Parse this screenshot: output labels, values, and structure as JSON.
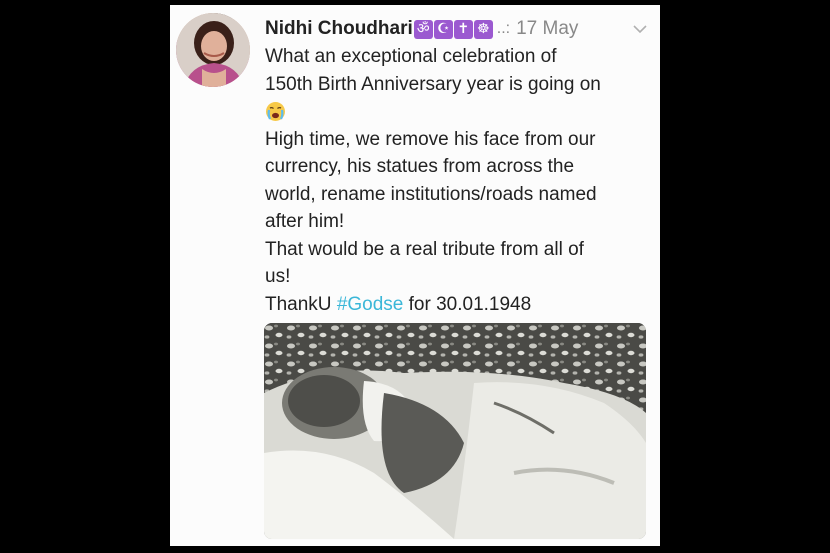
{
  "tweet": {
    "author_name": "Nidhi Choudhari",
    "name_emojis": [
      "ॐ",
      "☪",
      "✝",
      "☸"
    ],
    "handle_truncated": "..:",
    "date": "17 May",
    "more_icon": "chevron-down-icon",
    "text_lines": {
      "l1": "What an exceptional celebration of",
      "l2": "150th Birth Anniversary year is going on",
      "l3_emoji": "crying-face-emoji",
      "l4": "High time, we remove his face from our",
      "l5": "currency, his statues from across the",
      "l6": "world, rename institutions/roads named",
      "l7": "after him!",
      "l8": "That would be a real tribute from all of",
      "l9": "us!",
      "l10_prefix": "ThankU ",
      "l10_hashtag": "#Godse",
      "l10_suffix": " for 30.01.1948"
    },
    "colors": {
      "hashtag": "#3bb7d8",
      "emoji_box": "#9b59d0",
      "text": "#222222",
      "meta": "#888888"
    }
  }
}
